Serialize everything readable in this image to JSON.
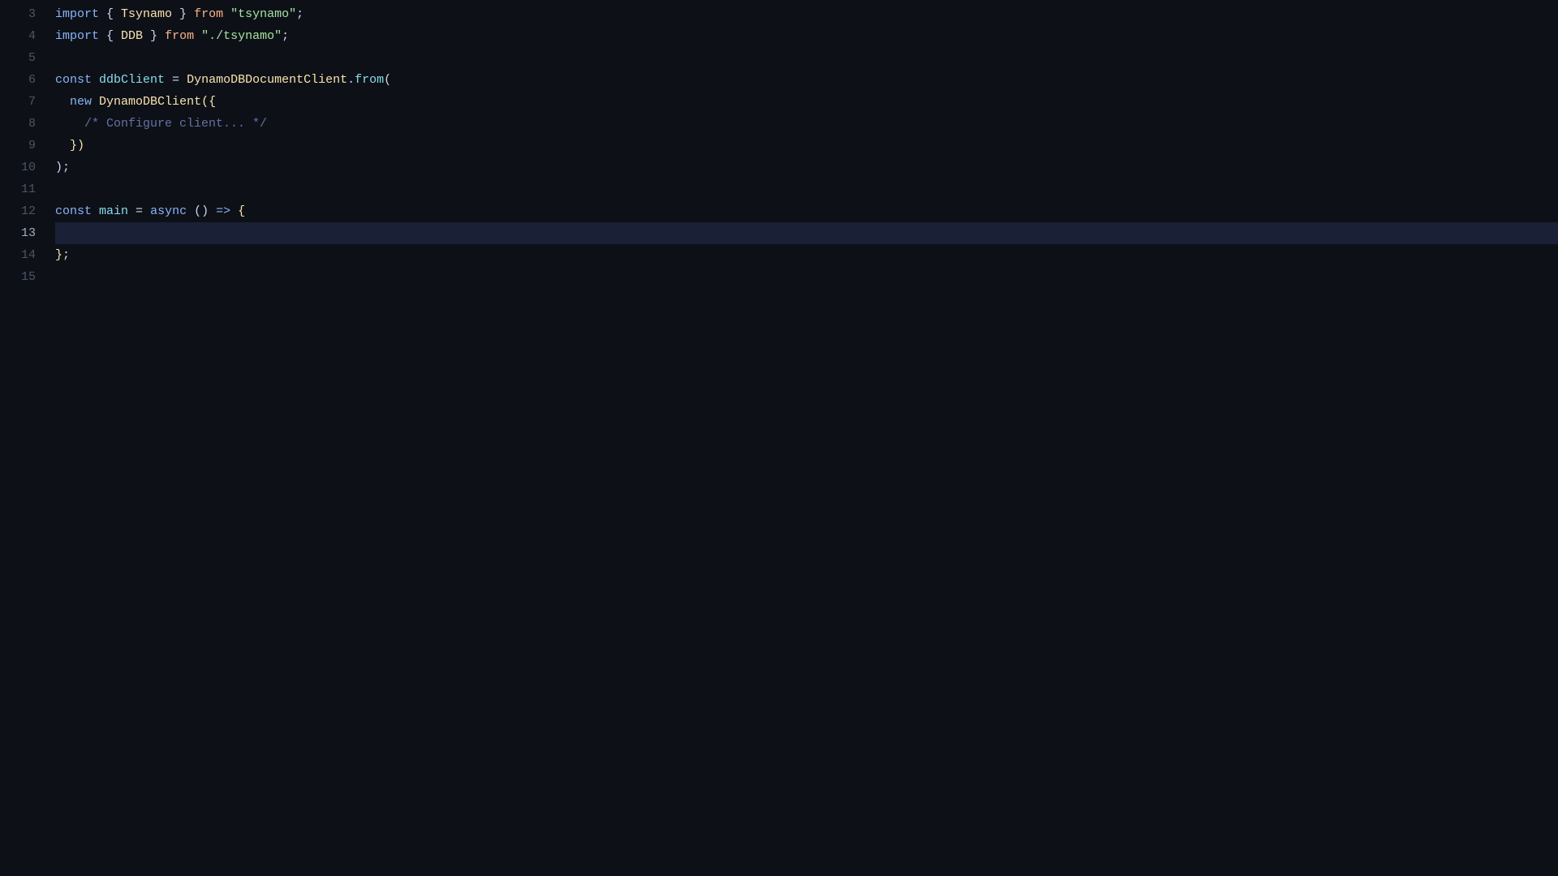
{
  "editor": {
    "background": "#0d1117",
    "lines": [
      {
        "number": 3,
        "active": false,
        "tokens": [
          {
            "type": "kw",
            "text": "import"
          },
          {
            "type": "punct",
            "text": " { "
          },
          {
            "type": "cls",
            "text": "Tsynamo"
          },
          {
            "type": "punct",
            "text": " } "
          },
          {
            "type": "kw-orange",
            "text": "from"
          },
          {
            "type": "punct",
            "text": " "
          },
          {
            "type": "str",
            "text": "\"tsynamo\""
          },
          {
            "type": "punct",
            "text": ";"
          }
        ]
      },
      {
        "number": 4,
        "active": false,
        "tokens": [
          {
            "type": "kw",
            "text": "import"
          },
          {
            "type": "punct",
            "text": " { "
          },
          {
            "type": "cls",
            "text": "DDB"
          },
          {
            "type": "punct",
            "text": " } "
          },
          {
            "type": "kw-orange",
            "text": "from"
          },
          {
            "type": "punct",
            "text": " "
          },
          {
            "type": "str",
            "text": "\"./tsynamo\""
          },
          {
            "type": "punct",
            "text": ";"
          }
        ]
      },
      {
        "number": 5,
        "active": false,
        "tokens": []
      },
      {
        "number": 6,
        "active": false,
        "tokens": [
          {
            "type": "kw",
            "text": "const"
          },
          {
            "type": "punct",
            "text": " "
          },
          {
            "type": "fn",
            "text": "ddbClient"
          },
          {
            "type": "punct",
            "text": " = "
          },
          {
            "type": "cls",
            "text": "DynamoDBDocumentClient"
          },
          {
            "type": "punct",
            "text": "."
          },
          {
            "type": "method",
            "text": "from"
          },
          {
            "type": "punct",
            "text": "("
          }
        ]
      },
      {
        "number": 7,
        "active": false,
        "tokens": [
          {
            "type": "punct",
            "text": "  "
          },
          {
            "type": "kw",
            "text": "new"
          },
          {
            "type": "punct",
            "text": " "
          },
          {
            "type": "cls",
            "text": "DynamoDBClient"
          },
          {
            "type": "brace-yellow",
            "text": "({"
          }
        ]
      },
      {
        "number": 8,
        "active": false,
        "tokens": [
          {
            "type": "punct",
            "text": "    "
          },
          {
            "type": "comment",
            "text": "/* Configure client... */"
          }
        ]
      },
      {
        "number": 9,
        "active": false,
        "tokens": [
          {
            "type": "punct",
            "text": "  "
          },
          {
            "type": "brace-yellow",
            "text": "})"
          }
        ]
      },
      {
        "number": 10,
        "active": false,
        "tokens": [
          {
            "type": "punct",
            "text": ");"
          }
        ]
      },
      {
        "number": 11,
        "active": false,
        "tokens": []
      },
      {
        "number": 12,
        "active": false,
        "tokens": [
          {
            "type": "kw",
            "text": "const"
          },
          {
            "type": "punct",
            "text": " "
          },
          {
            "type": "fn",
            "text": "main"
          },
          {
            "type": "punct",
            "text": " = "
          },
          {
            "type": "kw",
            "text": "async"
          },
          {
            "type": "punct",
            "text": " () "
          },
          {
            "type": "arrow",
            "text": "=>"
          },
          {
            "type": "punct",
            "text": " "
          },
          {
            "type": "brace-yellow",
            "text": "{"
          }
        ]
      },
      {
        "number": 13,
        "active": true,
        "tokens": []
      },
      {
        "number": 14,
        "active": false,
        "tokens": [
          {
            "type": "brace-yellow",
            "text": "}"
          },
          {
            "type": "punct",
            "text": ";"
          }
        ]
      },
      {
        "number": 15,
        "active": false,
        "tokens": []
      }
    ]
  }
}
